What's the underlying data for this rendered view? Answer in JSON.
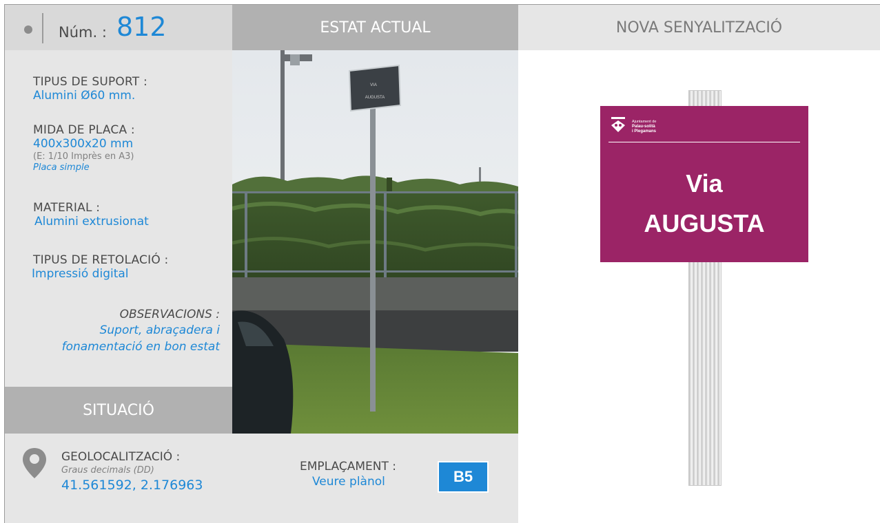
{
  "header": {
    "num_label": "Núm. :",
    "num_value": "812",
    "estat_title": "ESTAT ACTUAL",
    "nova_title": "NOVA SENYALITZACIÓ"
  },
  "specs": {
    "suport_label": "TIPUS DE SUPORT :",
    "suport_value": "Alumini Ø60 mm.",
    "mida_label": "MIDA DE PLACA :",
    "mida_value": "400x300x20 mm",
    "mida_scale": "(E: 1/10 Imprès en A3)",
    "mida_type": "Placa simple",
    "material_label": "MATERIAL :",
    "material_value": "Alumini extrusionat",
    "retolacio_label": "TIPUS DE RETOLACIÓ :",
    "retolacio_value": "Impressió digital",
    "obs_label": "OBSERVACIONS :",
    "obs_line1": "Suport, abraçadera i",
    "obs_line2": "fonamentació en bon estat"
  },
  "situacio": {
    "title": "SITUACIÓ",
    "geo_label": "GEOLOCALITZACIÓ :",
    "geo_sub": "Graus decimals (DD)",
    "geo_value": "41.561592, 2.176963",
    "empl_label": "EMPLAÇAMENT :",
    "empl_link": "Veure plànol",
    "empl_code": "B5"
  },
  "photo": {
    "sign_line1": "VIA",
    "sign_line2": "AUGUSTA"
  },
  "new_sign": {
    "org_line1": "Ajuntament de",
    "org_line2": "Palau-solità",
    "org_line3": "i Plegamans",
    "line1": "Via",
    "line2": "AUGUSTA",
    "color": "#9b2466"
  },
  "colors": {
    "accent": "#1e88d6",
    "panel_gray": "#e6e6e6",
    "bar_gray": "#b1b1b1"
  }
}
